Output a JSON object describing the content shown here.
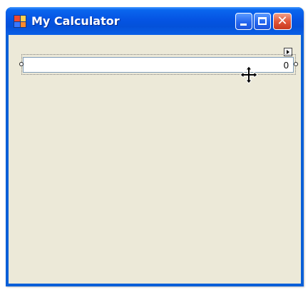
{
  "window": {
    "title": "My Calculator",
    "title_color": "#ffffff",
    "titlebar_color": "#0554e3",
    "client_color": "#ece9d8"
  },
  "titlebar_buttons": {
    "minimize_icon": "minimize-icon",
    "maximize_icon": "maximize-icon",
    "close_icon": "close-icon",
    "close_glyph": "✕"
  },
  "designer": {
    "textbox_value": "0",
    "selection_handles": [
      "left",
      "right"
    ],
    "smart_tag_icon": "arrow-right-icon",
    "cursor_icon": "move-cursor-icon"
  }
}
